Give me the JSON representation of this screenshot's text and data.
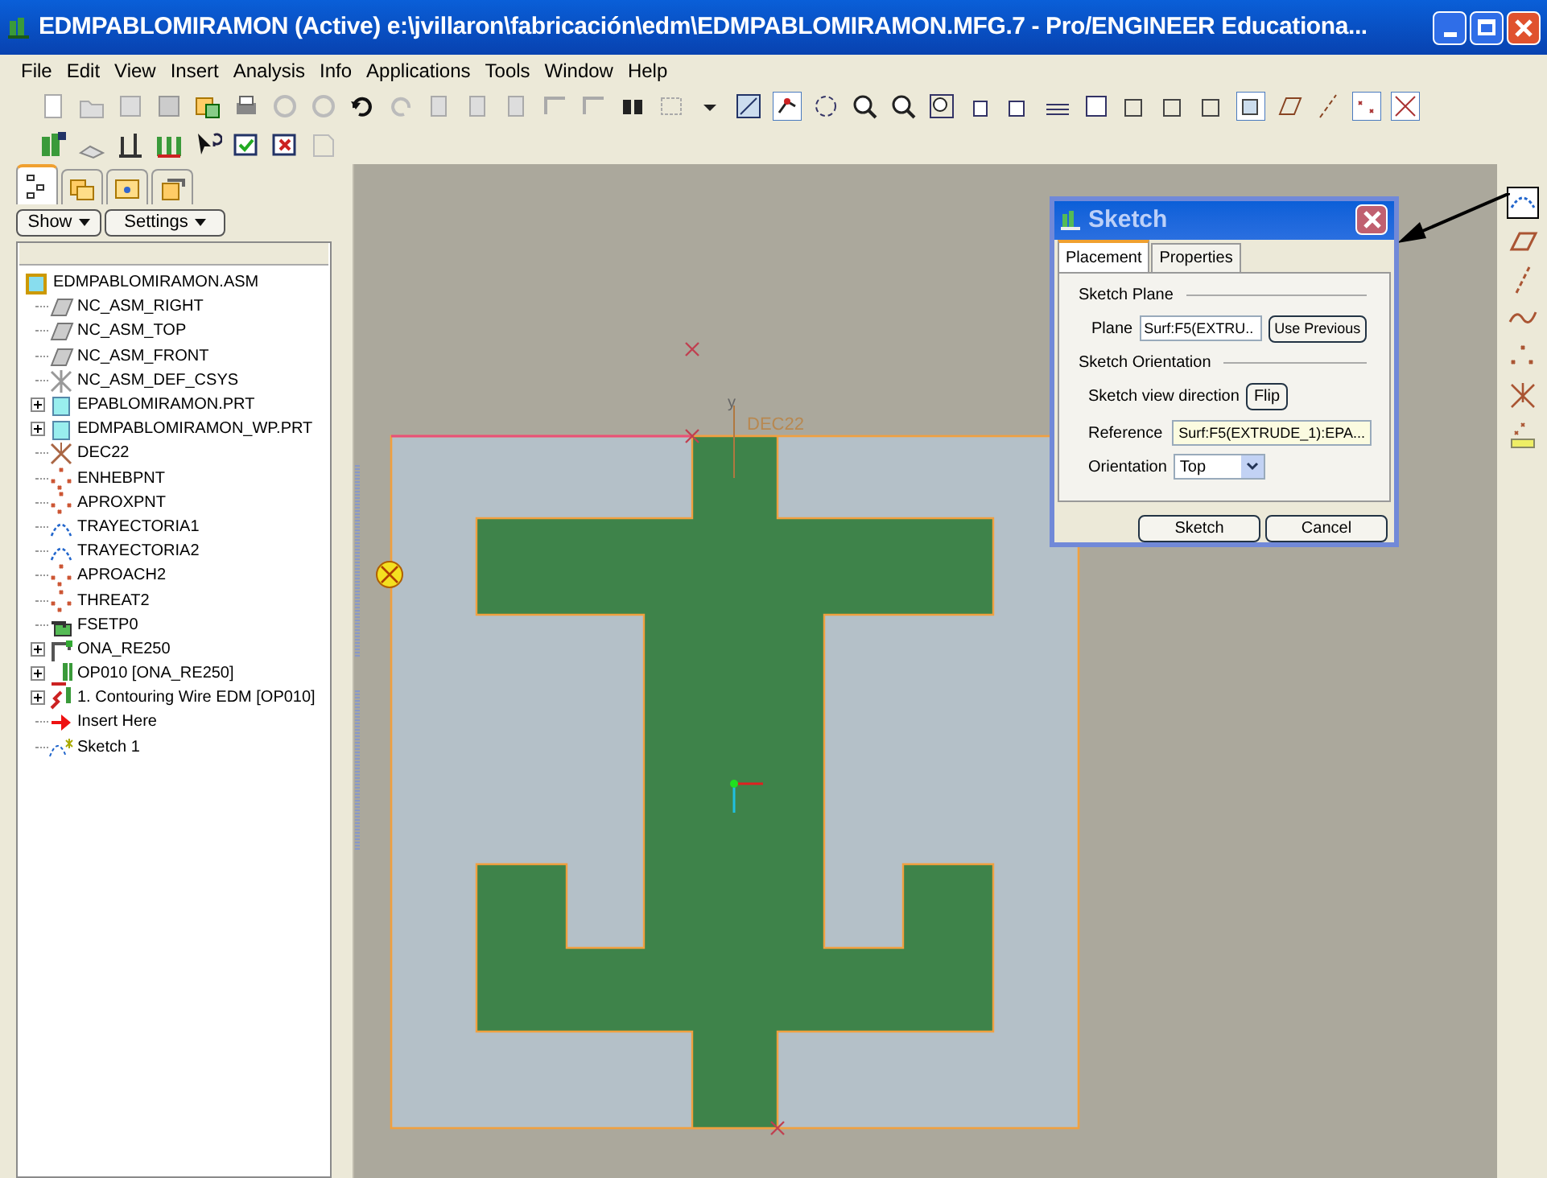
{
  "window": {
    "title": "EDMPABLOMIRAMON (Active) e:\\jvillaron\\fabricación\\edm\\EDMPABLOMIRAMON.MFG.7 - Pro/ENGINEER Educationa..."
  },
  "menu": [
    "File",
    "Edit",
    "View",
    "Insert",
    "Analysis",
    "Info",
    "Applications",
    "Tools",
    "Window",
    "Help"
  ],
  "panel_tabs": [
    {
      "selected": true
    },
    {
      "selected": false
    },
    {
      "selected": false
    },
    {
      "selected": false
    }
  ],
  "panel_buttons": [
    "Show",
    "Settings"
  ],
  "tree": {
    "label": "EDMPABLOMIRAMON.ASM",
    "kind": "assembly",
    "children": [
      {
        "label": "NC_ASM_RIGHT",
        "kind": "plane",
        "expander": false
      },
      {
        "label": "NC_ASM_TOP",
        "kind": "plane",
        "expander": false
      },
      {
        "label": "NC_ASM_FRONT",
        "kind": "plane",
        "expander": false
      },
      {
        "label": "NC_ASM_DEF_CSYS",
        "kind": "csys",
        "expander": false
      },
      {
        "label": "EPABLOMIRAMON.PRT",
        "kind": "part",
        "expander": true
      },
      {
        "label": "EDMPABLOMIRAMON_WP.PRT",
        "kind": "part",
        "expander": true
      },
      {
        "label": "DEC22",
        "kind": "csys2",
        "expander": false
      },
      {
        "label": "ENHEBPNT",
        "kind": "points",
        "expander": false
      },
      {
        "label": "APROXPNT",
        "kind": "points",
        "expander": false
      },
      {
        "label": "TRAYECTORIA1",
        "kind": "curve",
        "expander": false
      },
      {
        "label": "TRAYECTORIA2",
        "kind": "curve",
        "expander": false
      },
      {
        "label": "APROACH2",
        "kind": "points",
        "expander": false
      },
      {
        "label": "THREAT2",
        "kind": "points",
        "expander": false
      },
      {
        "label": "FSETP0",
        "kind": "fixture",
        "expander": false
      },
      {
        "label": "ONA_RE250",
        "kind": "machine",
        "expander": true
      },
      {
        "label": "OP010 [ONA_RE250]",
        "kind": "operation",
        "expander": true
      },
      {
        "label": "1. Contouring Wire EDM [OP010]",
        "kind": "sequence",
        "expander": true
      },
      {
        "label": "Insert Here",
        "kind": "insert",
        "expander": false
      },
      {
        "label": "Sketch 1",
        "kind": "sketch",
        "expander": false
      }
    ]
  },
  "canvas": {
    "csys_label": "DEC22",
    "axis_label": "y"
  },
  "dialog": {
    "title": "Sketch",
    "tabs": [
      {
        "label": "Placement",
        "selected": true
      },
      {
        "label": "Properties",
        "selected": false
      }
    ],
    "plane_section": "Sketch Plane",
    "plane_label": "Plane",
    "plane_value": "Surf:F5(EXTRU..",
    "use_previous": "Use Previous",
    "orientation_section": "Sketch Orientation",
    "direction_label": "Sketch view direction",
    "flip": "Flip",
    "reference_label": "Reference",
    "reference_value": "Surf:F5(EXTRUDE_1):EPA...",
    "orientation_label": "Orientation",
    "orientation_value": "Top",
    "buttons": [
      "Sketch",
      "Cancel"
    ]
  }
}
